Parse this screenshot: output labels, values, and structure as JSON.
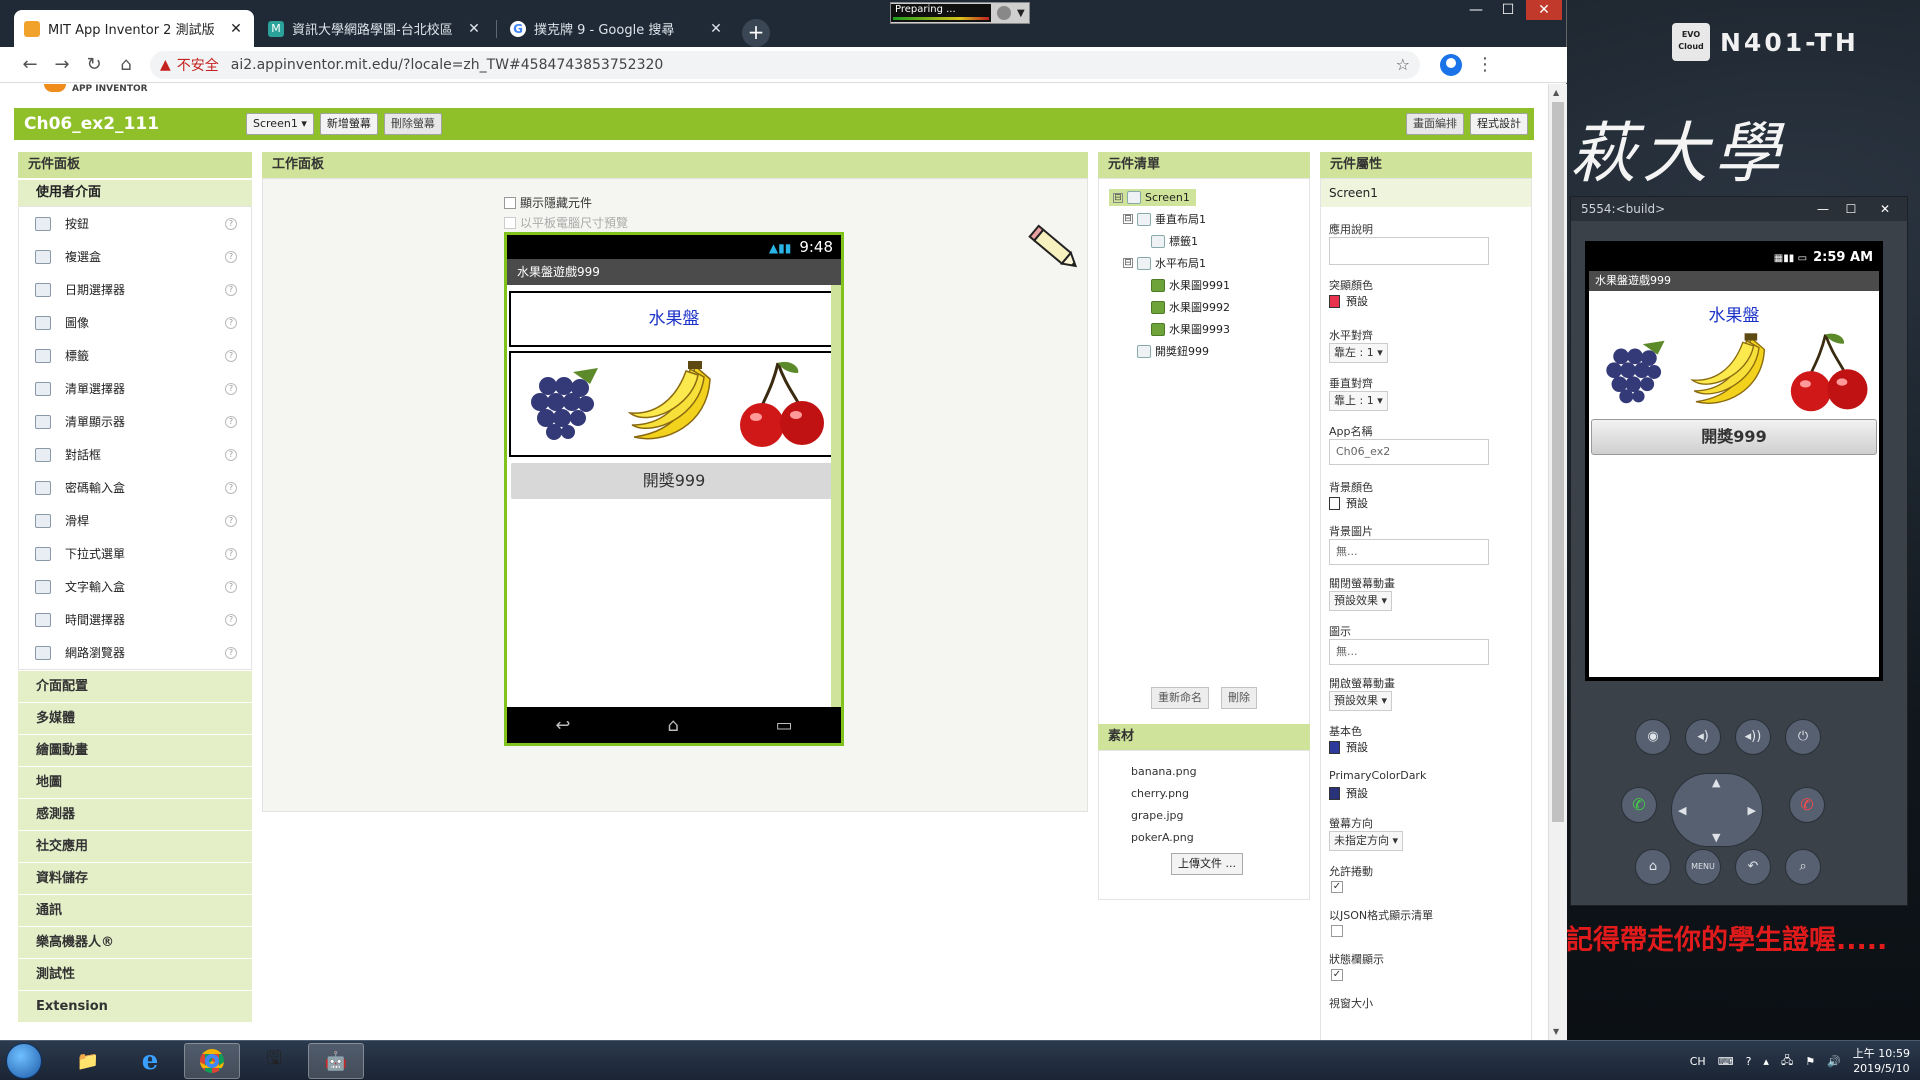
{
  "browser": {
    "tabs": [
      {
        "title": "MIT App Inventor 2 測試版",
        "active": true,
        "icon": "app-inventor-icon"
      },
      {
        "title": "資訊大學網路學園-台北校區",
        "active": false,
        "icon": "moodle-icon"
      },
      {
        "title": "撲克牌 9 - Google 搜尋",
        "active": false,
        "icon": "google-icon"
      }
    ],
    "new_tab": "+",
    "recorder_status": "Preparing ...",
    "window_controls": {
      "minimize": "—",
      "maximize": "☐",
      "close": "✕"
    },
    "insecure_label": "不安全",
    "url": "ai2.appinventor.mit.edu/?locale=zh_TW#4584743853752320"
  },
  "app": {
    "logo_text": "APP INVENTOR",
    "project_name": "Ch06_ex2_111",
    "screen_select": "Screen1 ▾",
    "add_screen": "新增螢幕",
    "remove_screen": "刪除螢幕",
    "designer": "畫面編排",
    "blocks": "程式設計"
  },
  "palette": {
    "title": "元件面板",
    "open_category": "使用者介面",
    "items": [
      {
        "label": "按鈕",
        "icon": "button-icon"
      },
      {
        "label": "複選盒",
        "icon": "checkbox-icon"
      },
      {
        "label": "日期選擇器",
        "icon": "datepicker-icon"
      },
      {
        "label": "圖像",
        "icon": "image-icon"
      },
      {
        "label": "標籤",
        "icon": "label-icon"
      },
      {
        "label": "清單選擇器",
        "icon": "listpicker-icon"
      },
      {
        "label": "清單顯示器",
        "icon": "listview-icon"
      },
      {
        "label": "對話框",
        "icon": "notifier-icon"
      },
      {
        "label": "密碼輸入盒",
        "icon": "password-icon"
      },
      {
        "label": "滑桿",
        "icon": "slider-icon"
      },
      {
        "label": "下拉式選單",
        "icon": "spinner-icon"
      },
      {
        "label": "文字輸入盒",
        "icon": "textbox-icon"
      },
      {
        "label": "時間選擇器",
        "icon": "timepicker-icon"
      },
      {
        "label": "網路瀏覽器",
        "icon": "webviewer-icon"
      }
    ],
    "help": "?",
    "categories": [
      "介面配置",
      "多媒體",
      "繪圖動畫",
      "地圖",
      "感測器",
      "社交應用",
      "資料儲存",
      "通訊",
      "樂高機器人®",
      "測試性",
      "Extension"
    ]
  },
  "viewer": {
    "title": "工作面板",
    "show_hidden": "顯示隱藏元件",
    "tablet_preview": "以平板電腦尺寸預覽",
    "status_time": "9:48",
    "app_title": "水果盤遊戲999",
    "label_text": "水果盤",
    "button_text": "開獎999"
  },
  "components": {
    "title": "元件清單",
    "tree": [
      {
        "label": "Screen1",
        "level": 0,
        "toggle": "⊟",
        "icon": "screen-icon",
        "selected": true
      },
      {
        "label": "垂直布局1",
        "level": 1,
        "toggle": "⊟",
        "icon": "vertical-arrangement-icon"
      },
      {
        "label": "標籤1",
        "level": 2,
        "icon": "label-icon"
      },
      {
        "label": "水平布局1",
        "level": 1,
        "toggle": "⊟",
        "icon": "horizontal-arrangement-icon"
      },
      {
        "label": "水果圖9991",
        "level": 2,
        "icon": "image-icon"
      },
      {
        "label": "水果圖9992",
        "level": 2,
        "icon": "image-icon"
      },
      {
        "label": "水果圖9993",
        "level": 2,
        "icon": "image-icon"
      },
      {
        "label": "開獎鈕999",
        "level": 1,
        "icon": "button-icon"
      }
    ],
    "rename": "重新命名",
    "delete": "刪除"
  },
  "media": {
    "title": "素材",
    "files": [
      "banana.png",
      "cherry.png",
      "grape.jpg",
      "pokerA.png"
    ],
    "upload": "上傳文件 ..."
  },
  "properties": {
    "title": "元件屬性",
    "component": "Screen1",
    "about_label": "應用說明",
    "accent_label": "突顯顏色",
    "accent_value": "預設",
    "accent_color": "#e8324e",
    "align_h_label": "水平對齊",
    "align_h_value": "靠左 : 1 ▾",
    "align_v_label": "垂直對齊",
    "align_v_value": "靠上 : 1 ▾",
    "appname_label": "App名稱",
    "appname_value": "Ch06_ex2",
    "bgcolor_label": "背景顏色",
    "bgcolor_value": "預設",
    "bgimage_label": "背景圖片",
    "bgimage_value": "無...",
    "close_anim_label": "關閉螢幕動畫",
    "close_anim_value": "預設效果 ▾",
    "icon_label": "圖示",
    "icon_value": "無...",
    "open_anim_label": "開啟螢幕動畫",
    "open_anim_value": "預設效果 ▾",
    "primary_label": "基本色",
    "primary_value": "預設",
    "primary_color": "#2d3a9c",
    "primary_dark_label": "PrimaryColorDark",
    "primary_dark_value": "預設",
    "primary_dark_color": "#2a337a",
    "orientation_label": "螢幕方向",
    "orientation_value": "未指定方向 ▾",
    "scrollable_label": "允許捲動",
    "json_label": "以JSON格式顯示清單",
    "statusbar_label": "狀態欄顯示",
    "sizing_label": "視窗大小",
    "checked_mark": "✓"
  },
  "emulator": {
    "title": "5554:<build>",
    "time": "2:59 AM",
    "app_title": "水果盤遊戲999",
    "label_text": "水果盤",
    "button_text": "開獎999",
    "menu_key": "MENU"
  },
  "desktop": {
    "net_badge_label": "N401-TH",
    "cloud_text": "EVO Cloud",
    "calligraphy": "萩大學",
    "reminder": "記得帶走你的學生證喔....."
  },
  "taskbar": {
    "lang": "CH",
    "time": "上午 10:59",
    "date": "2019/5/10"
  }
}
